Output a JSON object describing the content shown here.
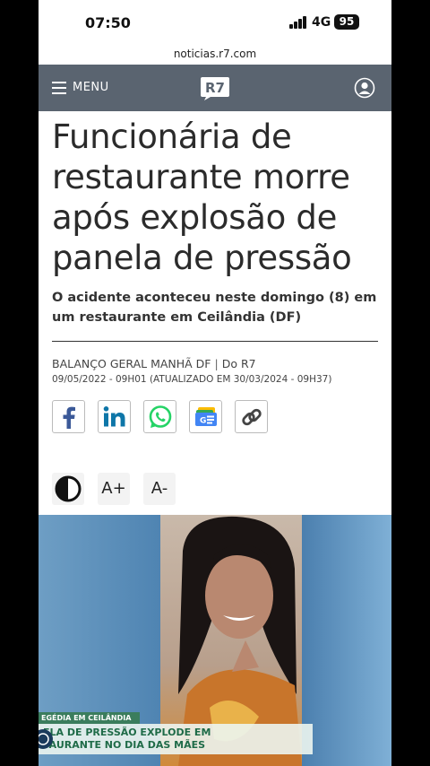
{
  "status_bar": {
    "time": "07:50",
    "network": "4G",
    "battery": "95"
  },
  "browser": {
    "url": "noticias.r7.com"
  },
  "header": {
    "menu_label": "MENU",
    "logo_text": "R7"
  },
  "article": {
    "title": "Funcionária de restaurante morre após explosão de panela de pressão",
    "subtitle": "O acidente aconteceu neste domingo (8) em um restaurante em Ceilândia (DF)",
    "program": "BALANÇO GERAL MANHÃ DF",
    "separator": "|",
    "author": "Do R7",
    "dates": "09/05/2022 - 09H01 (ATUALIZADO EM 30/03/2024 - 09H37)"
  },
  "share": [
    {
      "icon": "facebook-icon",
      "color": "#3b5998"
    },
    {
      "icon": "linkedin-icon",
      "color": "#0e76a8"
    },
    {
      "icon": "whatsapp-icon",
      "color": "#25d366"
    },
    {
      "icon": "google-news-icon",
      "color": "#4285f4"
    },
    {
      "icon": "link-icon",
      "color": "#444444"
    }
  ],
  "tools": {
    "contrast_icon": "contrast-icon",
    "increase_font": "A+",
    "decrease_font": "A-"
  },
  "video": {
    "tag": "EGÉDIA EM CEILÂNDIA",
    "headline_line1": "ELA DE PRESSÃO EXPLODE EM",
    "headline_line2": "TAURANTE NO DIA DAS MÃES"
  }
}
